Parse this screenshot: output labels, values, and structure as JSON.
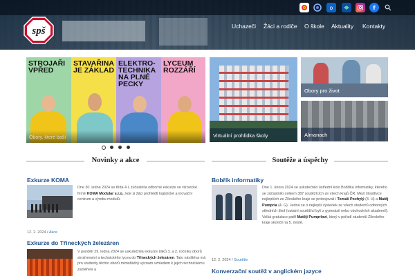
{
  "header": {
    "logo_text": "spš",
    "nav": [
      "Uchazeči",
      "Žáci a rodiče",
      "O škole",
      "Aktuality",
      "Kontakty"
    ],
    "colors": {
      "accent": "#c8102e",
      "link": "#1f4f8a"
    }
  },
  "social_icons": [
    "google-arts-icon",
    "circle-logo-icon",
    "outlook-icon",
    "edupage-icon",
    "instagram-icon",
    "facebook-icon",
    "search-icon"
  ],
  "slider": {
    "panels": [
      "Strojaři vpřed",
      "Stavařina je základ",
      "Elektro-technika na plné pecky",
      "Lyceum rozzáří"
    ],
    "caption": "Obory, které baší",
    "dots": 4,
    "active_dot": 0
  },
  "tiles": {
    "virtual": "Virtuální prohlídka školy",
    "obory": "Obory pro život",
    "almanach": "Almanach"
  },
  "sections": {
    "news": "Novinky a akce",
    "contests": "Soutěže a úspěchy"
  },
  "news": [
    {
      "title": "Exkurze KOMA",
      "text_pre": "Dne 30. ledna 2024 se třída 4.L zúčastnila odborné exkurze ve vizovické firmě ",
      "bold": "KOMA Modular s.r.o.",
      "text_post": ", kde si žáci prohlédli logistické a inovační centrum a výrobu modulů.",
      "date": "12. 2. 2024",
      "tag": "Akce"
    },
    {
      "title": "Exkurze do Třineckých železáren",
      "text_pre": "V pondělí 29. ledna 2024 se uskutečnila exkurze žáků 3. a 2. ročníku oborů strojírenství a technického lycea do ",
      "bold": "Třineckých železáren",
      "text_post": ". Tato návštěva má pro studenty těchto oborů mimořádný význam vzhledem k jejich technickému zaměření a"
    }
  ],
  "contests": [
    {
      "title": "Bobřík informatiky",
      "text_pre": "Dne 1. února 2024 se uskutečnilo ústřední kolo Bobříka informatiky, kterého se zúčastnilo celkem 387 soutěžících ze všech krajů ČR. Mezi šťastlivce nejlepších ze Zlínského kraje se probojovali i ",
      "bold1": "Tomáš Pochylý",
      "text_mid": " (3. H) a ",
      "bold2": "Matěj Pumpria",
      "text_mid2": " (4. G). Jedná se o nejlepší výsledek ze všech studentů odborných středních škol (ostatní soutěžící byli z gymnázií nebo obchodních akademií). Velká gratulace patří ",
      "bold3": "Matěji Pumprlovi",
      "text_post": ", který v pořadí studentů Zlínského kraje skončil na 5. místě.",
      "date": "12. 2. 2024",
      "tag": "Soutěže"
    },
    {
      "title": "Konverzační soutěž v anglickém jazyce"
    }
  ]
}
